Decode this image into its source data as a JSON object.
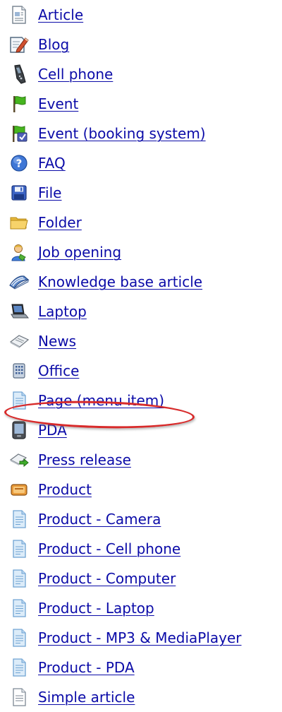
{
  "items": [
    {
      "label": "Article",
      "icon": "article-icon"
    },
    {
      "label": "Blog",
      "icon": "blog-icon"
    },
    {
      "label": "Cell phone",
      "icon": "cell-phone-icon"
    },
    {
      "label": "Event",
      "icon": "event-flag-icon"
    },
    {
      "label": "Event (booking system)",
      "icon": "event-booking-icon"
    },
    {
      "label": "FAQ",
      "icon": "faq-icon"
    },
    {
      "label": "File",
      "icon": "file-save-icon"
    },
    {
      "label": "Folder",
      "icon": "folder-icon"
    },
    {
      "label": "Job opening",
      "icon": "job-opening-icon"
    },
    {
      "label": "Knowledge base article",
      "icon": "knowledge-base-icon"
    },
    {
      "label": "Laptop",
      "icon": "laptop-icon"
    },
    {
      "label": "News",
      "icon": "news-icon"
    },
    {
      "label": "Office",
      "icon": "office-building-icon"
    },
    {
      "label": "Page (menu item)",
      "icon": "page-document-icon"
    },
    {
      "label": "PDA",
      "icon": "pda-icon"
    },
    {
      "label": "Press release",
      "icon": "press-release-icon"
    },
    {
      "label": "Product",
      "icon": "product-icon"
    },
    {
      "label": "Product - Camera",
      "icon": "page-document-icon"
    },
    {
      "label": "Product - Cell phone",
      "icon": "page-document-icon"
    },
    {
      "label": "Product - Computer",
      "icon": "page-document-icon"
    },
    {
      "label": "Product - Laptop",
      "icon": "page-document-icon"
    },
    {
      "label": "Product - MP3 & MediaPlayer",
      "icon": "page-document-icon"
    },
    {
      "label": "Product - PDA",
      "icon": "page-document-icon"
    },
    {
      "label": "Simple article",
      "icon": "simple-article-icon"
    }
  ],
  "colors": {
    "link": "#0b0ba8",
    "highlight": "#d82a2a"
  }
}
